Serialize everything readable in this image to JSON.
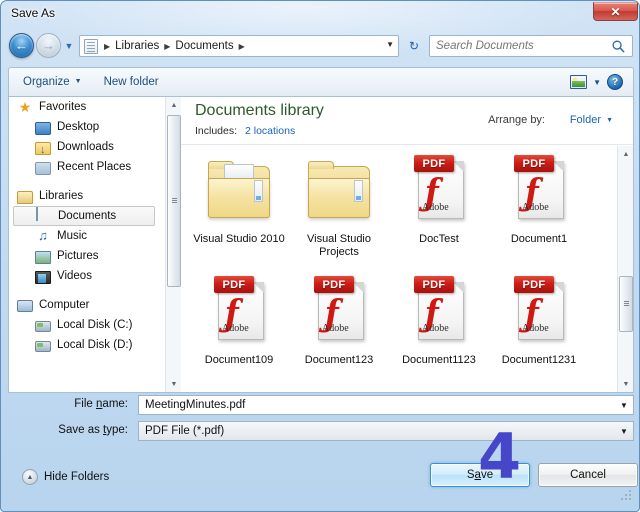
{
  "window": {
    "title": "Save As",
    "close_label": "✕"
  },
  "addressbar": {
    "back_icon": "back-arrow-icon",
    "forward_icon": "forward-arrow-icon",
    "back_glyph": "←",
    "forward_glyph": "→",
    "history_caret": "▼",
    "breadcrumbs": [
      "Libraries",
      "Documents"
    ],
    "separator": "▶",
    "dropdown_caret": "▼",
    "refresh_glyph": "↻"
  },
  "search": {
    "placeholder": "Search Documents",
    "value": "",
    "icon": "search-icon"
  },
  "toolbar": {
    "organize_label": "Organize",
    "organize_caret": "▼",
    "new_folder_label": "New folder",
    "view_caret": "▼",
    "help_label": "?"
  },
  "nav_pane": {
    "groups": [
      {
        "label": "Favorites",
        "icon": "star-icon",
        "items": [
          {
            "label": "Desktop",
            "icon": "desktop-icon"
          },
          {
            "label": "Downloads",
            "icon": "downloads-icon"
          },
          {
            "label": "Recent Places",
            "icon": "recent-places-icon"
          }
        ]
      },
      {
        "label": "Libraries",
        "icon": "library-folder-icon",
        "items": [
          {
            "label": "Documents",
            "icon": "document-icon",
            "selected": true
          },
          {
            "label": "Music",
            "icon": "music-note-icon"
          },
          {
            "label": "Pictures",
            "icon": "pictures-icon"
          },
          {
            "label": "Videos",
            "icon": "video-icon"
          }
        ]
      },
      {
        "label": "Computer",
        "icon": "computer-icon",
        "items": [
          {
            "label": "Local Disk (C:)",
            "icon": "disk-icon"
          },
          {
            "label": "Local Disk (D:)",
            "icon": "disk-icon"
          }
        ]
      }
    ]
  },
  "library": {
    "title": "Documents library",
    "includes_label": "Includes:",
    "includes_link": "2 locations",
    "arrange_label": "Arrange by:",
    "arrange_value": "Folder",
    "arrange_caret": "▼"
  },
  "files": [
    {
      "name": "Visual Studio 2010",
      "type": "folder"
    },
    {
      "name": "Visual Studio Projects",
      "type": "folder"
    },
    {
      "name": "DocTest",
      "type": "pdf"
    },
    {
      "name": "Document1",
      "type": "pdf"
    },
    {
      "name": "Document109",
      "type": "pdf"
    },
    {
      "name": "Document123",
      "type": "pdf"
    },
    {
      "name": "Document1123",
      "type": "pdf"
    },
    {
      "name": "Document1231",
      "type": "pdf"
    }
  ],
  "pdf_icon": {
    "banner_text": "PDF",
    "brand_text": "Adobe",
    "acrobat_glyph": "ƒ"
  },
  "form": {
    "filename_label_pre": "File ",
    "filename_label_accel": "n",
    "filename_label_post": "ame:",
    "filename_value": "MeetingMinutes.pdf",
    "filetype_label_pre": "Save as ",
    "filetype_label_accel": "t",
    "filetype_label_post": "ype:",
    "filetype_value": "PDF File (*.pdf)",
    "caret": "▼"
  },
  "footer": {
    "hide_folders_label": "Hide Folders",
    "hide_folders_caret": "▲",
    "save_pre": "S",
    "save_accel": "a",
    "save_post": "ve",
    "cancel_label": "Cancel"
  },
  "annotation": {
    "step_number": "4",
    "color": "#4646c8"
  },
  "colors": {
    "accent_blue": "#1a63b5",
    "library_title_green": "#2b5b29",
    "pdf_red": "#cc1e17",
    "close_red": "#bf3b32",
    "annotation_purple": "#4646c8"
  }
}
